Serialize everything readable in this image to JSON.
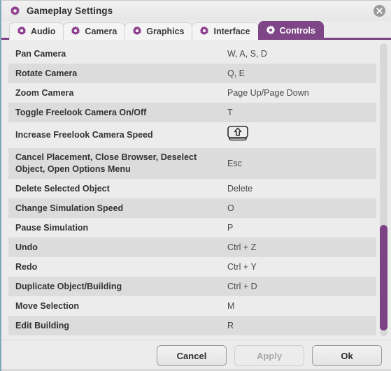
{
  "window": {
    "title": "Gameplay Settings",
    "title_icon": "gear-icon",
    "close_icon": "close-icon",
    "accent_color": "#7b4384",
    "active_tab_color": "#7e4687"
  },
  "tabs": [
    {
      "label": "Audio",
      "icon": "gear-icon",
      "active": false
    },
    {
      "label": "Camera",
      "icon": "gear-icon",
      "active": false
    },
    {
      "label": "Graphics",
      "icon": "gear-icon",
      "active": false
    },
    {
      "label": "Interface",
      "icon": "gear-icon",
      "active": false
    },
    {
      "label": "Controls",
      "icon": "gear-icon",
      "active": true
    }
  ],
  "bindings": [
    {
      "action": "Pan Camera",
      "key": "W, A, S, D",
      "key_type": "text"
    },
    {
      "action": "Rotate Camera",
      "key": "Q, E",
      "key_type": "text"
    },
    {
      "action": "Zoom Camera",
      "key": "Page Up/Page Down",
      "key_type": "text"
    },
    {
      "action": "Toggle Freelook Camera On/Off",
      "key": "T",
      "key_type": "text"
    },
    {
      "action": "Increase Freelook Camera Speed",
      "key": "Shift",
      "key_type": "keycap-shift"
    },
    {
      "action": "Cancel Placement, Close Browser, Deselect Object, Open Options Menu",
      "key": "Esc",
      "key_type": "text"
    },
    {
      "action": "Delete Selected Object",
      "key": "Delete",
      "key_type": "text"
    },
    {
      "action": "Change Simulation Speed",
      "key": "O",
      "key_type": "text"
    },
    {
      "action": "Pause Simulation",
      "key": "P",
      "key_type": "text"
    },
    {
      "action": "Undo",
      "key": "Ctrl + Z",
      "key_type": "text"
    },
    {
      "action": "Redo",
      "key": "Ctrl + Y",
      "key_type": "text"
    },
    {
      "action": "Duplicate Object/Building",
      "key": "Ctrl + D",
      "key_type": "text"
    },
    {
      "action": "Move Selection",
      "key": "M",
      "key_type": "text"
    },
    {
      "action": "Edit Building",
      "key": "R",
      "key_type": "text"
    }
  ],
  "scrollbar": {
    "thumb_top_percent": 62,
    "thumb_height_percent": 36,
    "thumb_color": "#7b4384"
  },
  "footer": {
    "buttons": [
      {
        "label": "Cancel",
        "disabled": false
      },
      {
        "label": "Apply",
        "disabled": true
      },
      {
        "label": "Ok",
        "disabled": false
      }
    ]
  }
}
